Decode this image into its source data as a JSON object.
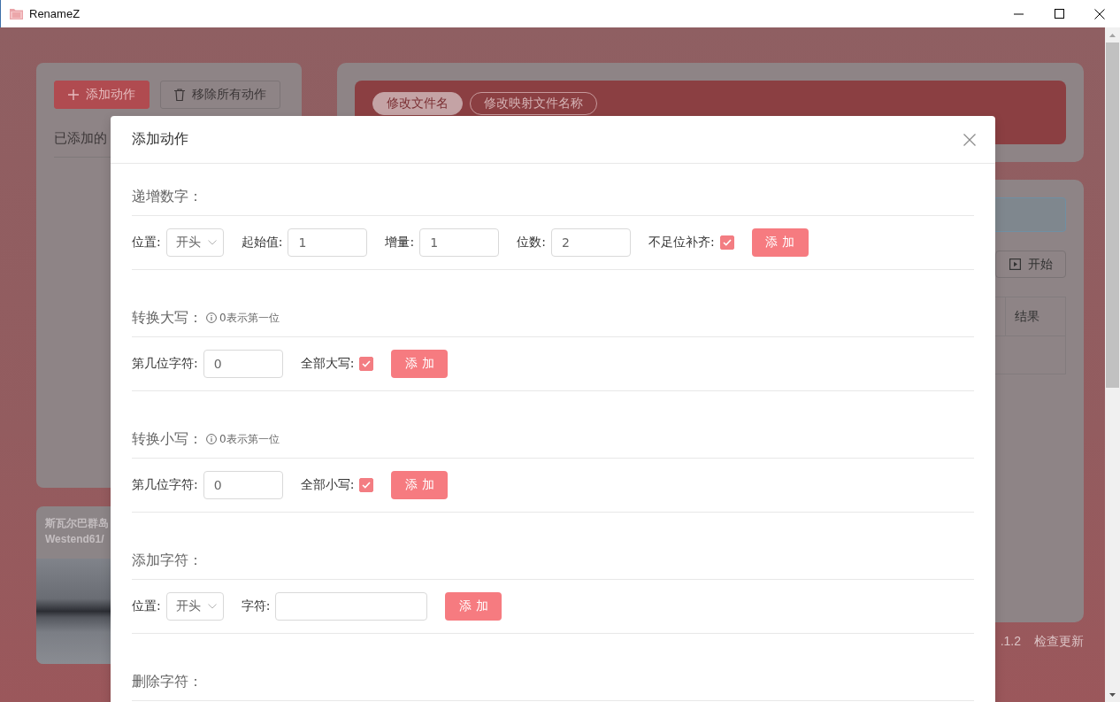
{
  "window": {
    "title": "RenameZ"
  },
  "background_app": {
    "actions_panel": {
      "buttons": [
        {
          "kind": "primary",
          "label": "添加动作"
        },
        {
          "kind": "default",
          "label": "移除所有动作"
        }
      ],
      "heading": "已添加的"
    },
    "wallpaper_card": {
      "caption": "斯瓦尔巴群岛",
      "credit": "Westend61/"
    },
    "mode_tabs": [
      {
        "label": "修改文件名",
        "selected": true
      },
      {
        "label": "修改映射文件名称",
        "selected": false
      }
    ],
    "start_button": {
      "label": "开始"
    },
    "table": {
      "columns": [
        "结果"
      ]
    },
    "footer": {
      "version": ".1.2",
      "update_link": "检查更新"
    }
  },
  "dialog": {
    "title": "添加动作",
    "sections": [
      {
        "title": "递增数字：",
        "fields": [
          {
            "kind": "select",
            "label": "位置:",
            "value": "开头"
          },
          {
            "kind": "number",
            "label": "起始值:",
            "value": "1"
          },
          {
            "kind": "number",
            "label": "增量:",
            "value": "1"
          },
          {
            "kind": "number",
            "label": "位数:",
            "value": "2"
          },
          {
            "kind": "checkbox",
            "label": "不足位补齐:",
            "checked": true
          }
        ],
        "button": "添 加"
      },
      {
        "title": "转换大写：",
        "hint": "0表示第一位",
        "fields": [
          {
            "kind": "number",
            "label": "第几位字符:",
            "value": "0"
          },
          {
            "kind": "checkbox",
            "label": "全部大写:",
            "checked": true
          }
        ],
        "button": "添 加"
      },
      {
        "title": "转换小写：",
        "hint": "0表示第一位",
        "fields": [
          {
            "kind": "number",
            "label": "第几位字符:",
            "value": "0"
          },
          {
            "kind": "checkbox",
            "label": "全部小写:",
            "checked": true
          }
        ],
        "button": "添 加"
      },
      {
        "title": "添加字符：",
        "fields": [
          {
            "kind": "select",
            "label": "位置:",
            "value": "开头"
          },
          {
            "kind": "text",
            "label": "字符:"
          }
        ],
        "button": "添 加"
      },
      {
        "title": "删除字符："
      }
    ]
  }
}
